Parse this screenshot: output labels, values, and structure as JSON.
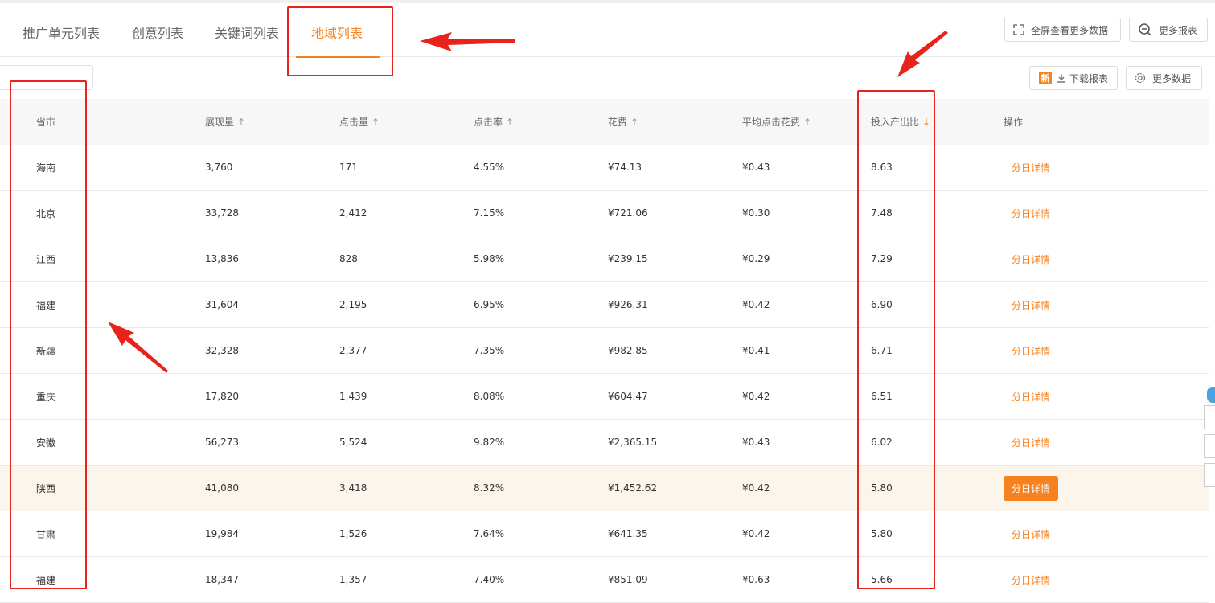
{
  "tabs": [
    {
      "label": "推广单元列表",
      "active": false
    },
    {
      "label": "创意列表",
      "active": false
    },
    {
      "label": "关键词列表",
      "active": false
    },
    {
      "label": "地域列表",
      "active": true
    }
  ],
  "toolbar": {
    "fullscreen_label": "全屏查看更多数据",
    "more_reports_label": "更多报表",
    "new_badge": "新",
    "download_label": "下载报表",
    "more_data_label": "更多数据"
  },
  "table": {
    "headers": [
      {
        "label": "省市",
        "sort": ""
      },
      {
        "label": "展现量",
        "sort": "↑"
      },
      {
        "label": "点击量",
        "sort": "↑"
      },
      {
        "label": "点击率",
        "sort": "↑"
      },
      {
        "label": "花费",
        "sort": "↑"
      },
      {
        "label": "平均点击花费",
        "sort": "↑"
      },
      {
        "label": "投入产出比",
        "sort": "↓"
      },
      {
        "label": "操作",
        "sort": ""
      }
    ],
    "action_label": "分日详情",
    "rows": [
      {
        "region": "海南",
        "impressions": "3,760",
        "clicks": "171",
        "ctr": "4.55%",
        "cost": "¥74.13",
        "cpc": "¥0.43",
        "roi": "8.63"
      },
      {
        "region": "北京",
        "impressions": "33,728",
        "clicks": "2,412",
        "ctr": "7.15%",
        "cost": "¥721.06",
        "cpc": "¥0.30",
        "roi": "7.48"
      },
      {
        "region": "江西",
        "impressions": "13,836",
        "clicks": "828",
        "ctr": "5.98%",
        "cost": "¥239.15",
        "cpc": "¥0.29",
        "roi": "7.29"
      },
      {
        "region": "福建",
        "impressions": "31,604",
        "clicks": "2,195",
        "ctr": "6.95%",
        "cost": "¥926.31",
        "cpc": "¥0.42",
        "roi": "6.90"
      },
      {
        "region": "新疆",
        "impressions": "32,328",
        "clicks": "2,377",
        "ctr": "7.35%",
        "cost": "¥982.85",
        "cpc": "¥0.41",
        "roi": "6.71"
      },
      {
        "region": "重庆",
        "impressions": "17,820",
        "clicks": "1,439",
        "ctr": "8.08%",
        "cost": "¥604.47",
        "cpc": "¥0.42",
        "roi": "6.51"
      },
      {
        "region": "安徽",
        "impressions": "56,273",
        "clicks": "5,524",
        "ctr": "9.82%",
        "cost": "¥2,365.15",
        "cpc": "¥0.43",
        "roi": "6.02"
      },
      {
        "region": "陕西",
        "impressions": "41,080",
        "clicks": "3,418",
        "ctr": "8.32%",
        "cost": "¥1,452.62",
        "cpc": "¥0.42",
        "roi": "5.80",
        "highlighted": true
      },
      {
        "region": "甘肃",
        "impressions": "19,984",
        "clicks": "1,526",
        "ctr": "7.64%",
        "cost": "¥641.35",
        "cpc": "¥0.42",
        "roi": "5.80"
      },
      {
        "region": "福建",
        "impressions": "18,347",
        "clicks": "1,357",
        "ctr": "7.40%",
        "cost": "¥851.09",
        "cpc": "¥0.63",
        "roi": "5.66"
      }
    ]
  },
  "colors": {
    "accent": "#f5821f",
    "annotation": "#e8231b",
    "highlight_row": "#fbf5ec"
  }
}
